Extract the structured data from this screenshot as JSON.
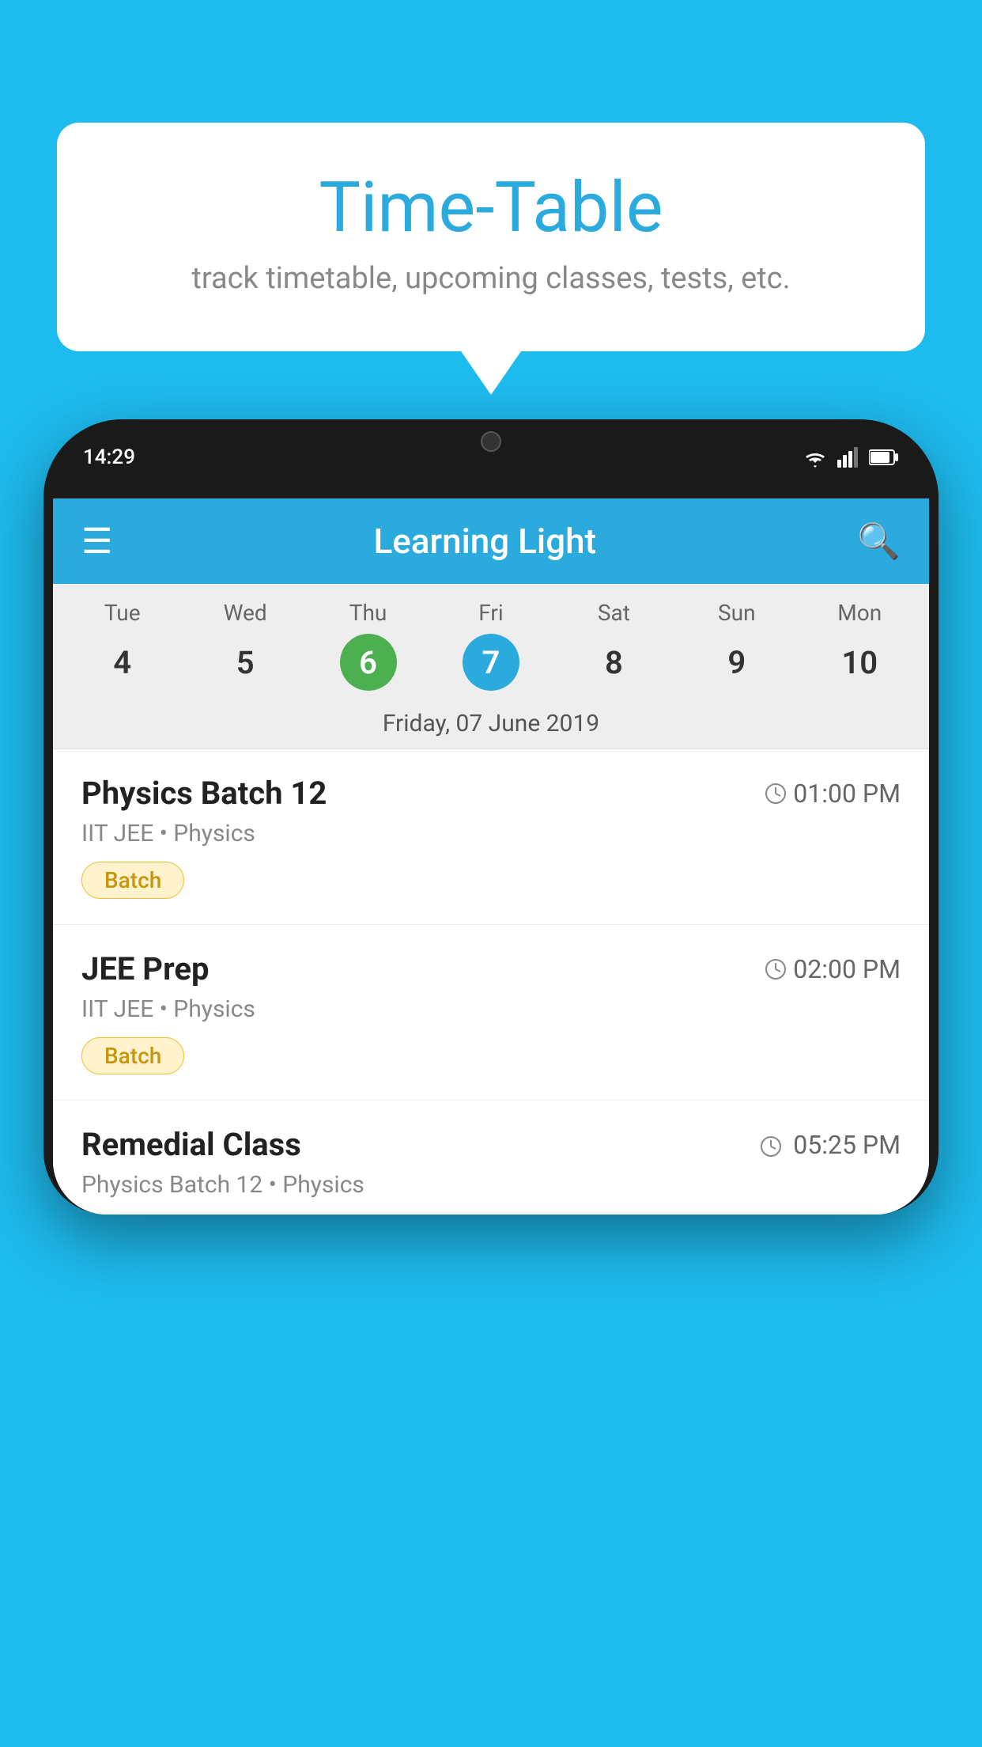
{
  "background_color": "#1EBBEE",
  "speech_bubble": {
    "title": "Time-Table",
    "subtitle": "track timetable, upcoming classes, tests, etc."
  },
  "phone": {
    "status_bar": {
      "time": "14:29",
      "icons": [
        "wifi",
        "signal",
        "battery"
      ]
    },
    "app_bar": {
      "title": "Learning Light"
    },
    "calendar": {
      "days": [
        {
          "label": "Tue",
          "num": "4",
          "state": "normal"
        },
        {
          "label": "Wed",
          "num": "5",
          "state": "normal"
        },
        {
          "label": "Thu",
          "num": "6",
          "state": "today"
        },
        {
          "label": "Fri",
          "num": "7",
          "state": "selected"
        },
        {
          "label": "Sat",
          "num": "8",
          "state": "normal"
        },
        {
          "label": "Sun",
          "num": "9",
          "state": "normal"
        },
        {
          "label": "Mon",
          "num": "10",
          "state": "normal"
        }
      ],
      "selected_date": "Friday, 07 June 2019"
    },
    "schedule": [
      {
        "title": "Physics Batch 12",
        "time": "01:00 PM",
        "subtitle": "IIT JEE • Physics",
        "badge": "Batch"
      },
      {
        "title": "JEE Prep",
        "time": "02:00 PM",
        "subtitle": "IIT JEE • Physics",
        "badge": "Batch"
      },
      {
        "title": "Remedial Class",
        "time": "05:25 PM",
        "subtitle": "Physics Batch 12 • Physics",
        "badge": null,
        "partial": true
      }
    ]
  }
}
